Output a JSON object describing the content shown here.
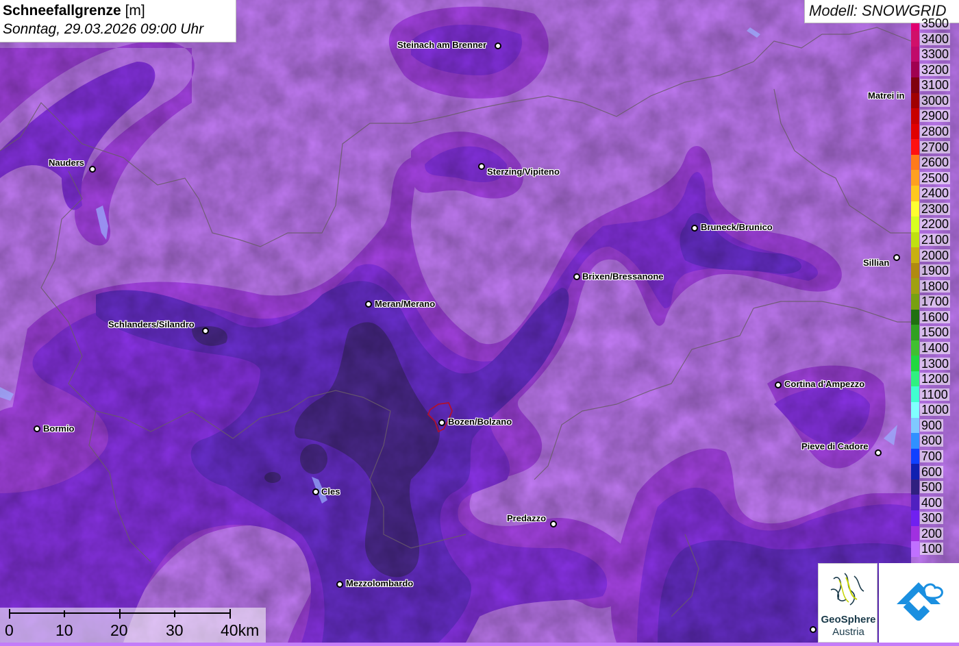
{
  "header": {
    "title_bold": "Schneefallgrenze",
    "title_unit": "[m]",
    "datetime": "Sonntag, 29.03.2026 09:00 Uhr"
  },
  "model": "Modell: SNOWGRID",
  "cities": [
    {
      "name": "Steinach am Brenner"
    },
    {
      "name": "Nauders"
    },
    {
      "name": "Sterzing/Vipiteno"
    },
    {
      "name": "Matrei in"
    },
    {
      "name": "Bruneck/Brunico"
    },
    {
      "name": "Sillian"
    },
    {
      "name": "Brixen/Bressanone"
    },
    {
      "name": "Meran/Merano"
    },
    {
      "name": "Schlanders/Silandro"
    },
    {
      "name": "Cortina d'Ampezzo"
    },
    {
      "name": "Bormio"
    },
    {
      "name": "Bozen/Bolzano"
    },
    {
      "name": "Pieve di Cadore"
    },
    {
      "name": "Cles"
    },
    {
      "name": "Predazzo"
    },
    {
      "name": "Mezzolombardo"
    }
  ],
  "legend": {
    "unit": "m",
    "levels": [
      {
        "value": "3500",
        "color": "#e0006f"
      },
      {
        "value": "3400",
        "color": "#d0106a"
      },
      {
        "value": "3300",
        "color": "#c00a6a"
      },
      {
        "value": "3200",
        "color": "#a00050"
      },
      {
        "value": "3100",
        "color": "#800010"
      },
      {
        "value": "3000",
        "color": "#a00000"
      },
      {
        "value": "2900",
        "color": "#c80000"
      },
      {
        "value": "2800",
        "color": "#e00000"
      },
      {
        "value": "2700",
        "color": "#ff1010"
      },
      {
        "value": "2600",
        "color": "#ff7a1a"
      },
      {
        "value": "2500",
        "color": "#ffa020"
      },
      {
        "value": "2400",
        "color": "#ffc81e"
      },
      {
        "value": "2300",
        "color": "#ffff30"
      },
      {
        "value": "2200",
        "color": "#d8ff20"
      },
      {
        "value": "2100",
        "color": "#c0e010"
      },
      {
        "value": "2000",
        "color": "#c8b010"
      },
      {
        "value": "1900",
        "color": "#b08a10"
      },
      {
        "value": "1800",
        "color": "#a0a010"
      },
      {
        "value": "1700",
        "color": "#78a010"
      },
      {
        "value": "1600",
        "color": "#207010"
      },
      {
        "value": "1500",
        "color": "#30a020"
      },
      {
        "value": "1400",
        "color": "#40c030"
      },
      {
        "value": "1300",
        "color": "#20d840"
      },
      {
        "value": "1200",
        "color": "#30f080"
      },
      {
        "value": "1100",
        "color": "#40ffd0"
      },
      {
        "value": "1000",
        "color": "#80ffff"
      },
      {
        "value": "900",
        "color": "#80c8ff"
      },
      {
        "value": "800",
        "color": "#3090ff"
      },
      {
        "value": "700",
        "color": "#1040ff"
      },
      {
        "value": "600",
        "color": "#1020b0"
      },
      {
        "value": "500",
        "color": "#302080"
      },
      {
        "value": "400",
        "color": "#5020c0"
      },
      {
        "value": "300",
        "color": "#7020f0"
      },
      {
        "value": "200",
        "color": "#a030e0"
      },
      {
        "value": "100",
        "color": "#c070ff"
      }
    ]
  },
  "scale_bar": {
    "labels": [
      "0",
      "10",
      "20",
      "30",
      "40km"
    ]
  },
  "logos": {
    "geosphere_line1": "GeoSphere",
    "geosphere_line2": "Austria"
  },
  "colors": {
    "base": "#c47cf8",
    "band_200": "#a844e8",
    "band_300": "#8a33e8",
    "band_400": "#6a2fd0",
    "band_500": "#4a2a8a"
  }
}
